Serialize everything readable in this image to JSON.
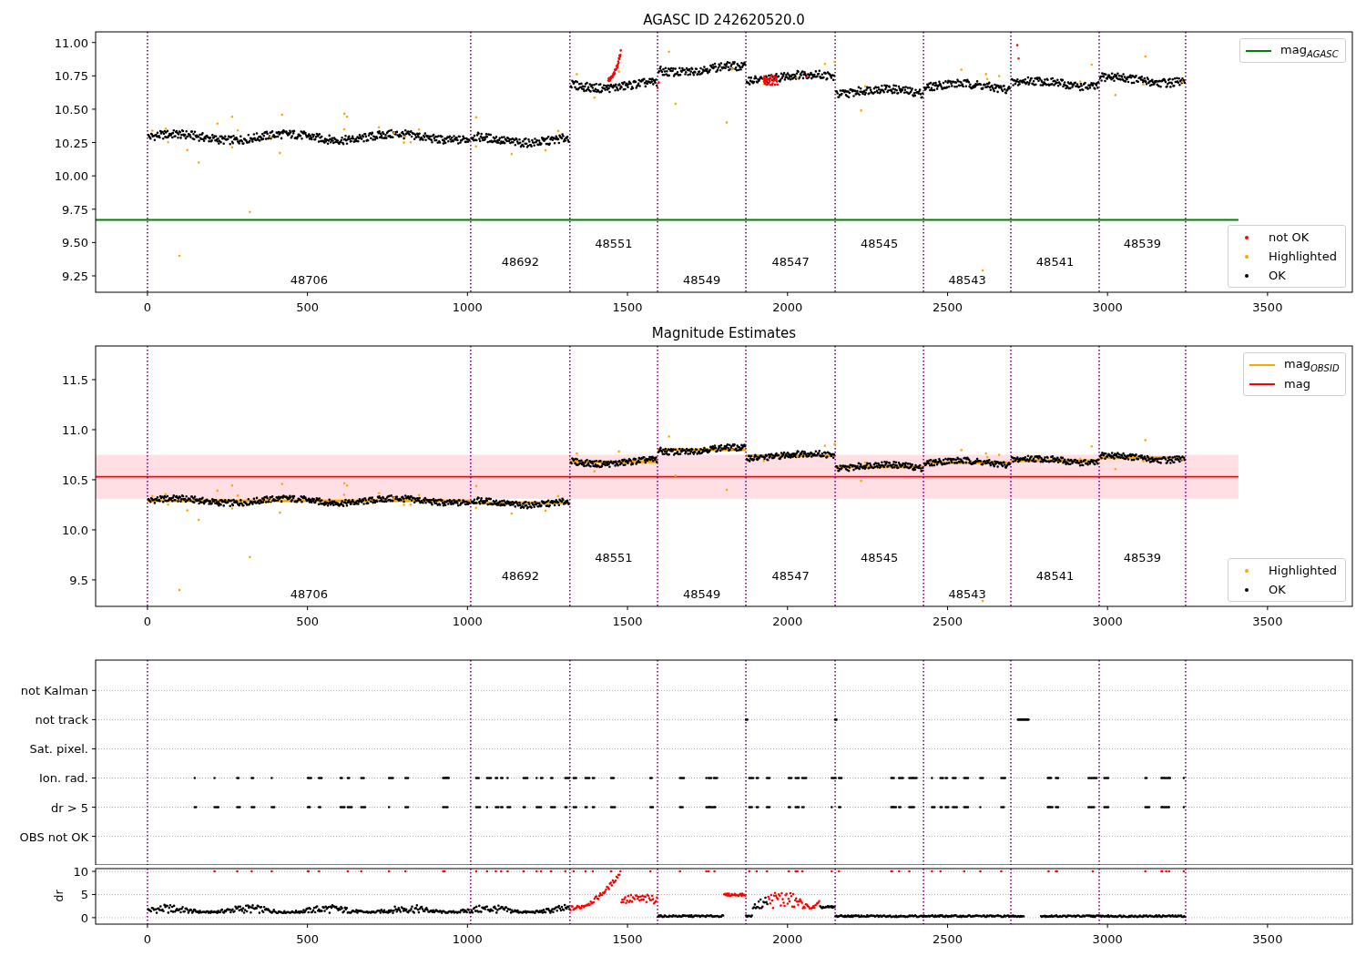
{
  "figure": {
    "panels": [
      {
        "kind": "magnitude",
        "chart_data": {
          "type": "scatter",
          "title": "AGASC ID 242620520.0",
          "xlim": [
            -162,
            3765
          ],
          "ylim": [
            9.127,
            11.08
          ],
          "xticks": [
            0,
            500,
            1000,
            1500,
            2000,
            2500,
            3000,
            3500
          ],
          "yticks": [
            {
              "value": 9.25,
              "label": "9.25"
            },
            {
              "value": 9.5,
              "label": "9.50"
            },
            {
              "value": 9.75,
              "label": "9.75"
            },
            {
              "value": 10,
              "label": "10.00"
            },
            {
              "value": 10.25,
              "label": "10.25"
            },
            {
              "value": 10.5,
              "label": "10.50"
            },
            {
              "value": 10.75,
              "label": "10.75"
            },
            {
              "value": 11,
              "label": "11.00"
            }
          ],
          "ref_lines": [
            {
              "axis": "x",
              "value": 0
            },
            {
              "axis": "x",
              "value": 1010
            },
            {
              "axis": "x",
              "value": 1320
            },
            {
              "axis": "x",
              "value": 1594
            },
            {
              "axis": "x",
              "value": 1870
            },
            {
              "axis": "x",
              "value": 2149
            },
            {
              "axis": "x",
              "value": 2425
            },
            {
              "axis": "x",
              "value": 2698
            },
            {
              "axis": "x",
              "value": 2974
            },
            {
              "axis": "x",
              "value": 3244
            }
          ],
          "series": [
            {
              "name": "mag$_{AGASC}$",
              "type": "line",
              "color": "#008000",
              "x": [
                -162,
                3409
              ],
              "values": [
                9.67,
                9.67
              ]
            }
          ],
          "annotations": [
            "48706",
            "48692",
            "48551",
            "48549",
            "48547",
            "48545",
            "48543",
            "48541",
            "48539"
          ]
        },
        "legends": [
          [
            {
              "label": "not OK",
              "kind": "dot",
              "color": "#ff0000"
            },
            {
              "label": "Highlighted",
              "kind": "dot",
              "color": "#ffa500"
            },
            {
              "label": "OK",
              "kind": "dot",
              "color": "#000000"
            }
          ]
        ]
      },
      {
        "kind": "estimates",
        "chart_data": {
          "type": "scatter",
          "title": "Magnitude Estimates",
          "xlim": [
            -162,
            3765
          ],
          "ylim": [
            9.236,
            11.836
          ],
          "xticks": [
            0,
            500,
            1000,
            1500,
            2000,
            2500,
            3000,
            3500
          ],
          "yticks": [
            {
              "value": 9.5,
              "label": "9.5"
            },
            {
              "value": 10,
              "label": "10.0"
            },
            {
              "value": 10.5,
              "label": "10.5"
            },
            {
              "value": 11,
              "label": "11.0"
            },
            {
              "value": 11.5,
              "label": "11.5"
            }
          ],
          "ref_lines": [
            {
              "axis": "x",
              "value": 0
            },
            {
              "axis": "x",
              "value": 1010
            },
            {
              "axis": "x",
              "value": 1320
            },
            {
              "axis": "x",
              "value": 1594
            },
            {
              "axis": "x",
              "value": 1870
            },
            {
              "axis": "x",
              "value": 2149
            },
            {
              "axis": "x",
              "value": 2425
            },
            {
              "axis": "x",
              "value": 2698
            },
            {
              "axis": "x",
              "value": 2974
            },
            {
              "axis": "x",
              "value": 3244
            }
          ],
          "bands": [
            {
              "axis": "y",
              "from": 10.31,
              "to": 10.75,
              "color": "#ffdfe3"
            }
          ],
          "series": [
            {
              "name": "mag$_{OBSID}$",
              "type": "line",
              "color": "#ffa500",
              "x": [
                0,
                1010,
                null,
                1010,
                1320,
                null,
                1320,
                1594,
                null,
                1594,
                1870,
                null,
                1870,
                2149,
                null,
                2149,
                2425,
                null,
                2425,
                2698,
                null,
                2698,
                2974,
                null,
                2974,
                3244
              ],
              "values": [
                10.29,
                10.29,
                null,
                10.27,
                10.27,
                null,
                10.68,
                10.68,
                null,
                10.8,
                10.8,
                null,
                10.74,
                10.74,
                null,
                10.63,
                10.63,
                null,
                10.67,
                10.67,
                null,
                10.69,
                10.69,
                null,
                10.72,
                10.72
              ]
            },
            {
              "name": "mag",
              "type": "line",
              "color": "#ff0000",
              "x": [
                -162,
                3409
              ],
              "values": [
                10.53,
                10.53
              ]
            }
          ],
          "annotations": [
            "48706",
            "48692",
            "48551",
            "48549",
            "48547",
            "48545",
            "48543",
            "48541",
            "48539"
          ]
        },
        "legends": [
          [
            {
              "label": "Highlighted",
              "kind": "dot",
              "color": "#ffa500"
            },
            {
              "label": "OK",
              "kind": "dot",
              "color": "#000000"
            }
          ]
        ]
      },
      {
        "kind": "flags",
        "chart_data": {
          "type": "scatter",
          "orientation": "horizontal",
          "xlim": [
            -162,
            3765
          ],
          "grid": true,
          "categories": [
            "not Kalman",
            "not track",
            "Sat. pixel.",
            "Ion. rad.",
            "dr > 5",
            "OBS not OK"
          ],
          "ref_lines": [
            {
              "axis": "x",
              "value": 0
            },
            {
              "axis": "x",
              "value": 1010
            },
            {
              "axis": "x",
              "value": 1320
            },
            {
              "axis": "x",
              "value": 1594
            },
            {
              "axis": "x",
              "value": 1870
            },
            {
              "axis": "x",
              "value": 2149
            },
            {
              "axis": "x",
              "value": 2425
            },
            {
              "axis": "x",
              "value": 2698
            },
            {
              "axis": "x",
              "value": 2974
            },
            {
              "axis": "x",
              "value": 3244
            }
          ]
        }
      },
      {
        "kind": "dr",
        "chart_data": {
          "type": "scatter",
          "ylabel": "dr",
          "xlim": [
            -162,
            3765
          ],
          "ylim": [
            -1.4,
            10.6
          ],
          "grid": true,
          "xticks": [
            0,
            500,
            1000,
            1500,
            2000,
            2500,
            3000,
            3500
          ],
          "yticks": [
            0,
            5,
            10
          ],
          "ref_lines": [
            {
              "axis": "x",
              "value": 0
            },
            {
              "axis": "x",
              "value": 1010
            },
            {
              "axis": "x",
              "value": 1320
            },
            {
              "axis": "x",
              "value": 1594
            },
            {
              "axis": "x",
              "value": 1870
            },
            {
              "axis": "x",
              "value": 2149
            },
            {
              "axis": "x",
              "value": 2425
            },
            {
              "axis": "x",
              "value": 2698
            },
            {
              "axis": "x",
              "value": 2974
            },
            {
              "axis": "x",
              "value": 3244
            }
          ]
        }
      }
    ]
  }
}
